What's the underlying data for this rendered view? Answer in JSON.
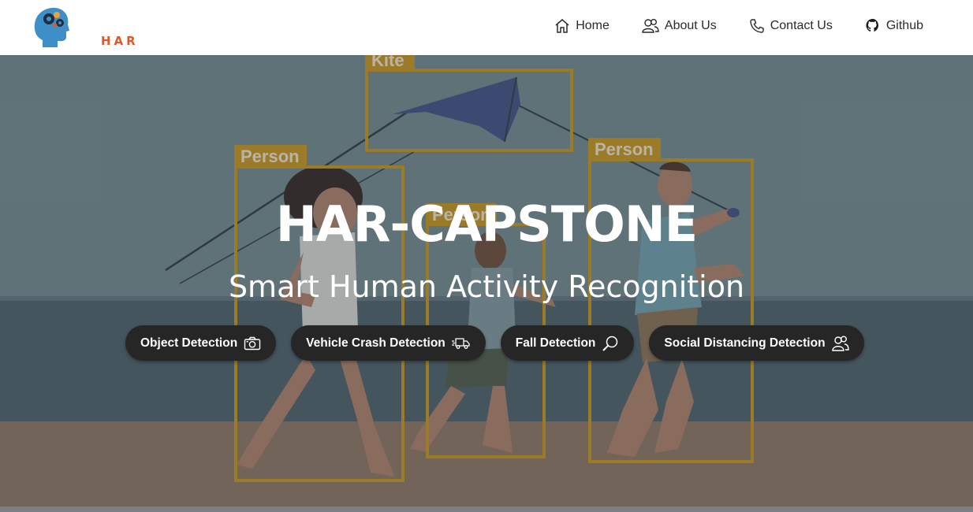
{
  "brand": {
    "logo_text": "HAR"
  },
  "nav": [
    {
      "label": "Home",
      "icon": "home-icon"
    },
    {
      "label": "About Us",
      "icon": "users-icon"
    },
    {
      "label": "Contact Us",
      "icon": "phone-icon"
    },
    {
      "label": "Github",
      "icon": "github-icon"
    }
  ],
  "hero": {
    "title": "HAR-CAPSTONE",
    "subtitle": "Smart Human Activity Recognition",
    "buttons": [
      {
        "label": "Object Detection",
        "icon": "camera-icon"
      },
      {
        "label": "Vehicle Crash Detection",
        "icon": "truck-icon"
      },
      {
        "label": "Fall Detection",
        "icon": "magnifier-icon"
      },
      {
        "label": "Social Distancing Detection",
        "icon": "people-icon"
      }
    ],
    "detection_labels": {
      "kite": "Kite",
      "person_left": "Person",
      "person_middle": "Person",
      "person_right": "Person"
    }
  },
  "colors": {
    "accent": "#e2562a",
    "box": "#c9951a",
    "pill_bg": "#262626"
  }
}
